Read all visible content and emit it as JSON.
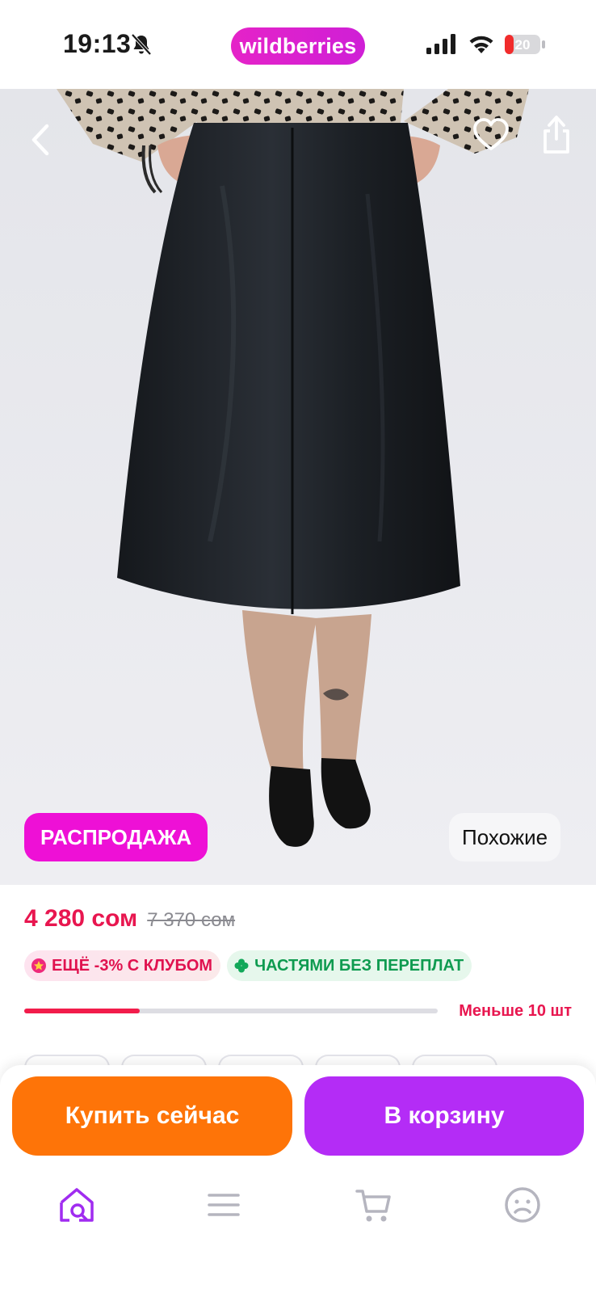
{
  "status_bar": {
    "time": "19:13",
    "brand": "wildberries",
    "battery": "20"
  },
  "product": {
    "sale_badge": "РАСПРОДАЖА",
    "similar_label": "Похожие",
    "price_current": "4 280 сом",
    "price_old": "7 370 сом",
    "chips": [
      {
        "label": "ЕЩЁ -3% С КЛУБОМ",
        "icon": "star-badge-icon"
      },
      {
        "label": "ЧАСТЯМИ БЕЗ ПЕРЕПЛАТ",
        "icon": "clover-icon"
      }
    ],
    "stock_label": "Меньше 10 шт",
    "stock_fraction": 0.28
  },
  "actions": {
    "buy_now": "Купить сейчас",
    "add_to_cart": "В корзину"
  },
  "tabbar": {
    "items": [
      "home-search-icon",
      "catalog-menu-icon",
      "cart-icon",
      "profile-icon"
    ],
    "active": "home-search-icon"
  },
  "colors": {
    "brand": "#cf1fd6",
    "price": "#e8164f",
    "buy_button": "#fe7408",
    "cart_button": "#b42cf6",
    "sale_badge": "#ee10d6",
    "tab_active": "#a02cf0",
    "tab_inactive": "#b5b5bf"
  }
}
